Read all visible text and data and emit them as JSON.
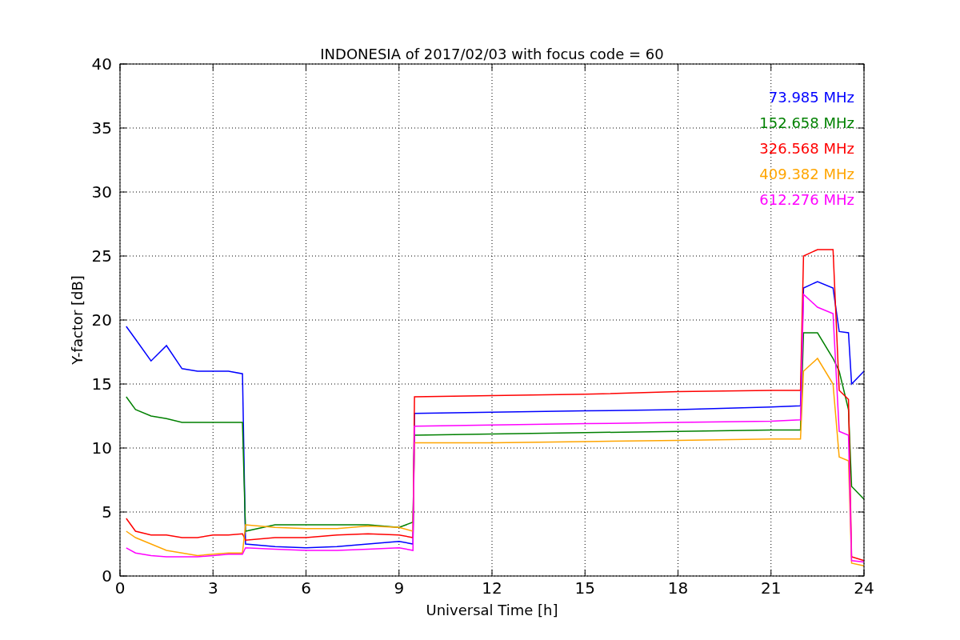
{
  "figure": {
    "chart_data": {
      "type": "line",
      "title": "INDONESIA of 2017/02/03 with focus code = 60",
      "xlabel": "Universal Time [h]",
      "ylabel": "Y-factor [dB]",
      "x": [
        0.2,
        0.5,
        1,
        1.5,
        2,
        2.5,
        3,
        3.5,
        3.95,
        4.05,
        5,
        6,
        7,
        8,
        9,
        9.45,
        9.5,
        12,
        15,
        18,
        21,
        21.95,
        22.05,
        22.5,
        23,
        23.2,
        23.5,
        23.6,
        24
      ],
      "series": [
        {
          "name": "73.985 MHz",
          "color": "#0000ff",
          "values": [
            19.5,
            18.5,
            16.8,
            18,
            16.2,
            16,
            16,
            16,
            15.8,
            2.5,
            2.3,
            2.2,
            2.3,
            2.5,
            2.7,
            2.5,
            12.7,
            12.8,
            12.9,
            13.0,
            13.2,
            13.3,
            22.5,
            23,
            22.5,
            19.1,
            19,
            15,
            16
          ]
        },
        {
          "name": "152.658 MHz",
          "color": "#008000",
          "values": [
            14,
            13,
            12.5,
            12.3,
            12,
            12,
            12,
            12,
            12,
            3.5,
            4,
            4,
            4,
            4,
            3.8,
            4.2,
            11.0,
            11.1,
            11.2,
            11.3,
            11.4,
            11.4,
            19,
            19,
            17,
            16,
            13,
            7,
            6
          ]
        },
        {
          "name": "326.568 MHz",
          "color": "#ff0000",
          "values": [
            4.5,
            3.5,
            3.2,
            3.2,
            3,
            3,
            3.2,
            3.2,
            3.3,
            2.8,
            3,
            3,
            3.2,
            3.3,
            3.2,
            3,
            14,
            14.1,
            14.2,
            14.4,
            14.5,
            14.5,
            25,
            25.5,
            25.5,
            14.5,
            13.8,
            1.5,
            1.2
          ]
        },
        {
          "name": "409.382 MHz",
          "color": "#ffa500",
          "values": [
            3.5,
            3,
            2.5,
            2,
            1.8,
            1.6,
            1.7,
            1.8,
            1.8,
            4,
            3.8,
            3.7,
            3.7,
            3.9,
            3.8,
            3.5,
            10.4,
            10.4,
            10.5,
            10.6,
            10.7,
            10.7,
            16,
            17,
            15,
            9.3,
            9,
            1,
            0.8
          ]
        },
        {
          "name": "612.276 MHz",
          "color": "#ff00ff",
          "values": [
            2.2,
            1.8,
            1.6,
            1.5,
            1.5,
            1.5,
            1.6,
            1.7,
            1.7,
            2.2,
            2.1,
            2,
            2,
            2.1,
            2.2,
            2,
            11.7,
            11.8,
            11.9,
            12,
            12.1,
            12.2,
            22,
            21,
            20.5,
            11.3,
            11,
            1.2,
            1.1
          ]
        }
      ],
      "xlim": [
        0,
        24
      ],
      "ylim": [
        0,
        40
      ],
      "xticks": [
        0,
        3,
        6,
        9,
        12,
        15,
        18,
        21,
        24
      ],
      "yticks": [
        0,
        5,
        10,
        15,
        20,
        25,
        30,
        35,
        40
      ],
      "grid": true
    }
  }
}
